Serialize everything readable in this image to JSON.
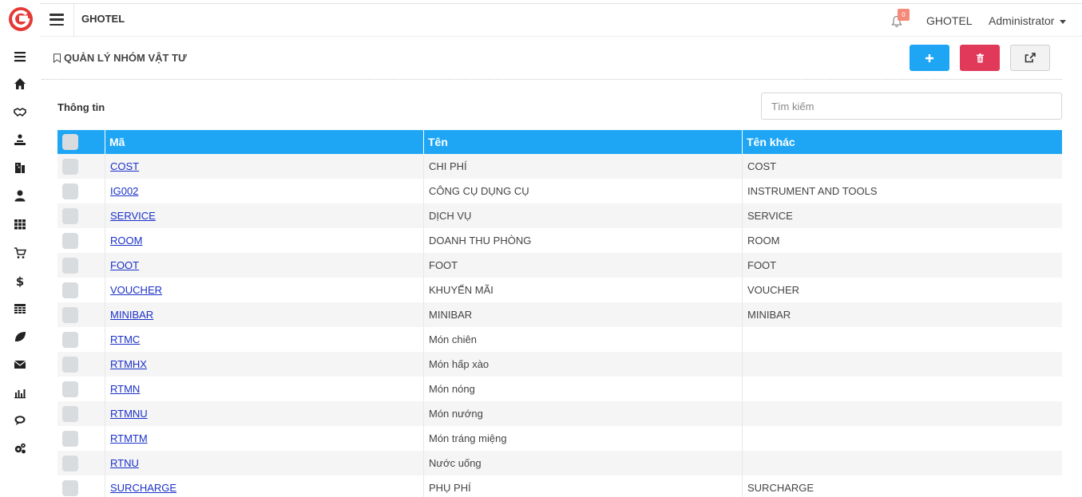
{
  "header": {
    "app_title": "GHOTEL",
    "notification_count": "0",
    "hotel_name": "GHOTEL",
    "user_name": "Administrator"
  },
  "page": {
    "title": "QUẢN LÝ NHÓM VẬT TƯ",
    "section_label": "Thông tin"
  },
  "search": {
    "placeholder": "Tìm kiếm",
    "value": ""
  },
  "colors": {
    "accent": "#1ea6f4",
    "danger": "#e0395a",
    "link": "#1a30c8",
    "logo": "#e53935"
  },
  "sidebar": {
    "items": [
      {
        "icon": "menu-icon"
      },
      {
        "icon": "home-icon"
      },
      {
        "icon": "handshake-icon"
      },
      {
        "icon": "reception-icon"
      },
      {
        "icon": "building-icon"
      },
      {
        "icon": "user-icon"
      },
      {
        "icon": "grid-icon"
      },
      {
        "icon": "cart-icon"
      },
      {
        "icon": "dollar-icon"
      },
      {
        "icon": "table-icon"
      },
      {
        "icon": "leaf-icon"
      },
      {
        "icon": "envelope-icon"
      },
      {
        "icon": "bar-chart-icon"
      },
      {
        "icon": "comments-icon"
      },
      {
        "icon": "cogs-icon"
      }
    ]
  },
  "table": {
    "headers": {
      "code": "Mã",
      "name": "Tên",
      "other_name": "Tên khác"
    },
    "rows": [
      {
        "code": "COST",
        "name": "CHI PHÍ",
        "other_name": "COST"
      },
      {
        "code": "IG002",
        "name": "CÔNG CỤ DỤNG CỤ",
        "other_name": "INSTRUMENT AND TOOLS"
      },
      {
        "code": "SERVICE",
        "name": "DỊCH VỤ",
        "other_name": "SERVICE"
      },
      {
        "code": "ROOM",
        "name": "DOANH THU PHÒNG",
        "other_name": "ROOM"
      },
      {
        "code": "FOOT",
        "name": "FOOT",
        "other_name": "FOOT"
      },
      {
        "code": "VOUCHER",
        "name": "KHUYẾN MÃI",
        "other_name": "VOUCHER"
      },
      {
        "code": "MINIBAR",
        "name": "MINIBAR",
        "other_name": "MINIBAR"
      },
      {
        "code": "RTMC",
        "name": "Món chiên",
        "other_name": ""
      },
      {
        "code": "RTMHX",
        "name": "Món hấp xào",
        "other_name": ""
      },
      {
        "code": "RTMN",
        "name": "Món nóng",
        "other_name": ""
      },
      {
        "code": "RTMNU",
        "name": "Món nướng",
        "other_name": ""
      },
      {
        "code": "RTMTM",
        "name": "Món tráng miệng",
        "other_name": ""
      },
      {
        "code": "RTNU",
        "name": "Nước uống",
        "other_name": ""
      },
      {
        "code": "SURCHARGE",
        "name": "PHỤ PHÍ",
        "other_name": "SURCHARGE"
      }
    ]
  }
}
